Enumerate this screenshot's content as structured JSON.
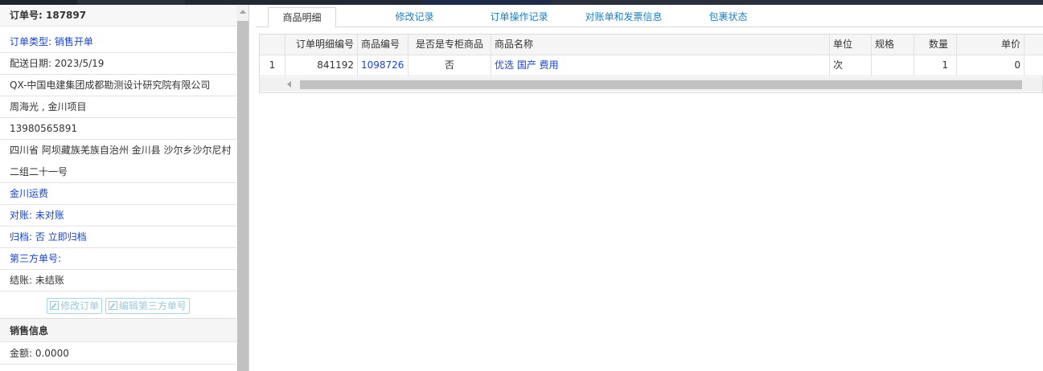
{
  "order": {
    "number_label": "订单号:",
    "number_value": "187897",
    "type": "订单类型: 销售开单",
    "delivery_date": "配送日期: 2023/5/19",
    "company": "QX-中国电建集团成都勘测设计研究院有限公司",
    "contact": "周海光 , 金川项目",
    "phone": "13980565891",
    "address": "四川省 阿坝藏族羌族自治州 金川县 沙尔乡沙尔尼村二组二十一号",
    "freight": "金川运费",
    "reconcile": "对账: 未对账",
    "archive_prefix": "归档: ",
    "archive_value": "否 立即归档",
    "third_party": "第三方单号:",
    "settle": "结账: 未结账",
    "edit_order_btn": "修改订单",
    "edit_third_btn": "编辑第三方单号"
  },
  "sales": {
    "title": "销售信息",
    "amount": "金额: 0.0000"
  },
  "tabs": [
    "商品明细",
    "修改记录",
    "订单操作记录",
    "对账单和发票信息",
    "包裹状态"
  ],
  "grid": {
    "headers": [
      "",
      "订单明细编号",
      "商品编号",
      "是否是专柜商品",
      "商品名称",
      "单位",
      "规格",
      "数量",
      "单价"
    ],
    "rows": [
      [
        "1",
        "841192",
        "1098726",
        "否",
        "优选 国产 费用",
        "次",
        "",
        "1",
        "0"
      ]
    ]
  },
  "colors": {
    "link_blue": "#1a44c9",
    "tab_blue": "#1a7fc1",
    "disabled_btn": "#9cc8de"
  }
}
